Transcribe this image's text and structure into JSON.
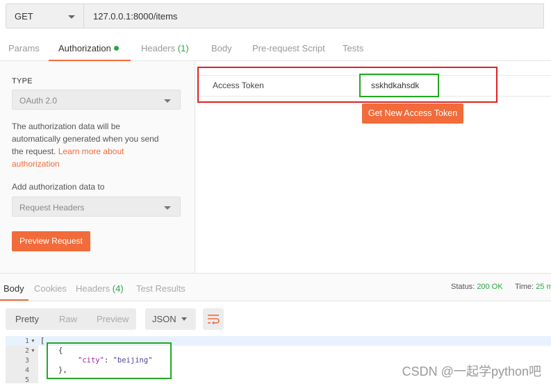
{
  "request": {
    "method": "GET",
    "url": "127.0.0.1:8000/items"
  },
  "request_tabs": {
    "params": "Params",
    "authorization": "Authorization",
    "headers": "Headers",
    "headers_count": "(1)",
    "body": "Body",
    "prerequest": "Pre-request Script",
    "tests": "Tests"
  },
  "auth": {
    "type_label": "TYPE",
    "type_value": "OAuth 2.0",
    "desc_line1": "The authorization data will be",
    "desc_line2": "automatically generated when you send",
    "desc_line3a": "the request. ",
    "desc_link1": "Learn more about",
    "desc_link2": "authorization",
    "add_label": "Add authorization data to",
    "add_value": "Request Headers",
    "preview_button": "Preview Request",
    "token_label": "Access Token",
    "token_value": "sskhdkahsdk",
    "get_token_button": "Get New Access Token"
  },
  "response_tabs": {
    "body": "Body",
    "cookies": "Cookies",
    "headers": "Headers",
    "headers_count": "(4)",
    "tests": "Test Results"
  },
  "status": {
    "status_label": "Status:",
    "status_value": "200 OK",
    "time_label": "Time:",
    "time_value": "25 m"
  },
  "format": {
    "pretty": "Pretty",
    "raw": "Raw",
    "preview": "Preview",
    "json": "JSON"
  },
  "code": {
    "line_numbers": [
      "1",
      "2",
      "3",
      "4",
      "5"
    ],
    "line1": "[",
    "line2": "{",
    "line3_key": "\"city\"",
    "line3_sep": ": ",
    "line3_val": "\"beijing\"",
    "line4": "},"
  },
  "watermark": "CSDN @一起学python吧",
  "colors": {
    "accent": "#f26b3a",
    "ok_green": "#28a745",
    "annotation_red": "#e02020",
    "annotation_green": "#22a822"
  }
}
